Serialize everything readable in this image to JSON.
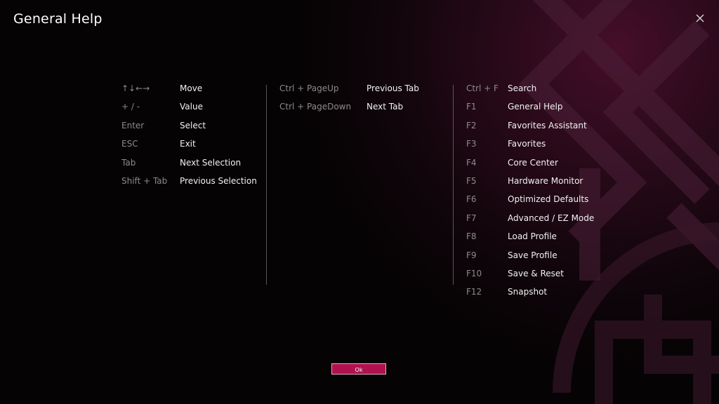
{
  "dialog": {
    "title": "General Help",
    "close_icon": "close-icon",
    "ok_label": "Ok"
  },
  "shortcuts": {
    "column1": [
      {
        "key": "↑↓←→",
        "desc": "Move"
      },
      {
        "key": "+ / -",
        "desc": "Value"
      },
      {
        "key": "Enter",
        "desc": "Select"
      },
      {
        "key": "ESC",
        "desc": "Exit"
      },
      {
        "key": "Tab",
        "desc": "Next Selection"
      },
      {
        "key": "Shift + Tab",
        "desc": "Previous Selection"
      }
    ],
    "column2": [
      {
        "key": "Ctrl + PageUp",
        "desc": "Previous Tab"
      },
      {
        "key": "Ctrl + PageDown",
        "desc": "Next Tab"
      }
    ],
    "column3": [
      {
        "key": "Ctrl + F",
        "desc": "Search"
      },
      {
        "key": "F1",
        "desc": "General Help"
      },
      {
        "key": "F2",
        "desc": "Favorites Assistant"
      },
      {
        "key": "F3",
        "desc": "Favorites"
      },
      {
        "key": "F4",
        "desc": "Core Center"
      },
      {
        "key": "F5",
        "desc": "Hardware Monitor"
      },
      {
        "key": "F6",
        "desc": "Optimized Defaults"
      },
      {
        "key": "F7",
        "desc": "Advanced / EZ Mode"
      },
      {
        "key": "F8",
        "desc": "Load Profile"
      },
      {
        "key": "F9",
        "desc": "Save Profile"
      },
      {
        "key": "F10",
        "desc": "Save & Reset"
      },
      {
        "key": "F12",
        "desc": "Snapshot"
      }
    ]
  },
  "colors": {
    "background": "#050304",
    "accent": "#b0124f",
    "key_text": "#8e8a8c",
    "desc_text": "#f2f2f2",
    "divider": "#5a5658"
  }
}
